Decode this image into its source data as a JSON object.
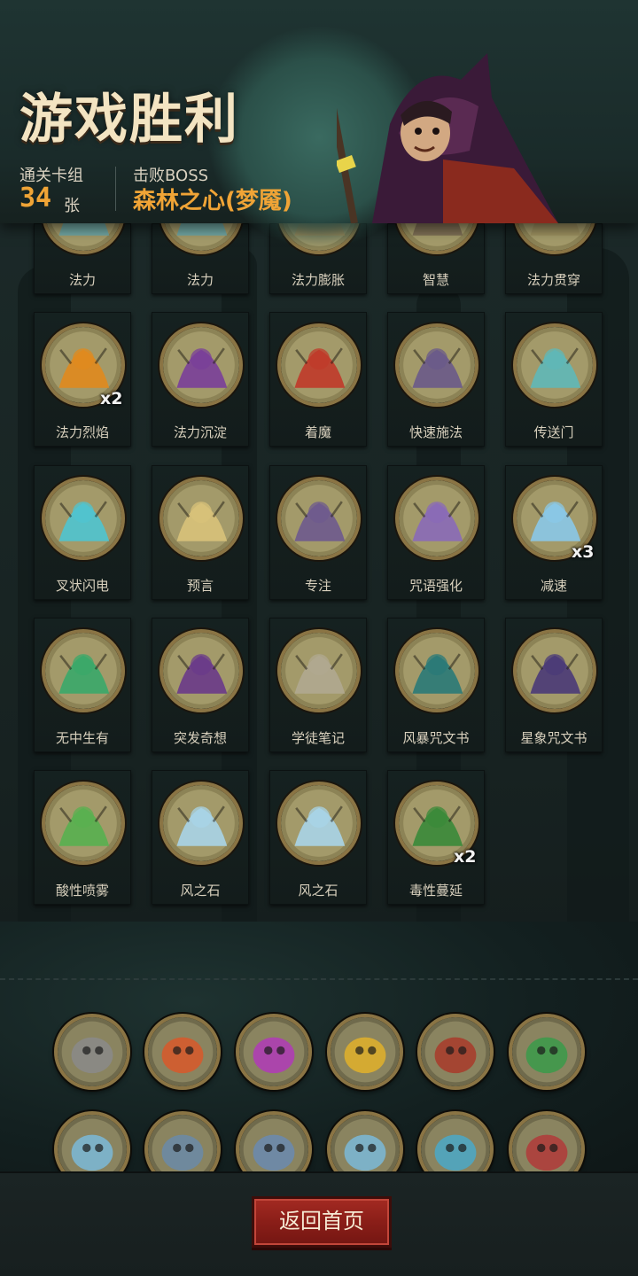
{
  "header": {
    "title": "游戏胜利",
    "deck_label": "通关卡组",
    "deck_count": "34",
    "deck_unit": "张",
    "boss_label": "击败BOSS",
    "boss_name": "森林之心(梦魇)"
  },
  "cards": [
    {
      "name": "法力",
      "count": "",
      "color": "#6aa7a8",
      "icon": "mana-eye-icon"
    },
    {
      "name": "法力",
      "count": "",
      "color": "#6aa7a8",
      "icon": "mana-eye-icon"
    },
    {
      "name": "法力膨胀",
      "count": "",
      "color": "#b5935a",
      "icon": "mana-swell-icon"
    },
    {
      "name": "智慧",
      "count": "",
      "color": "#7a6a52",
      "icon": "wisdom-icon"
    },
    {
      "name": "法力贯穿",
      "count": "",
      "color": "#9a8e5e",
      "icon": "mana-pierce-icon"
    },
    {
      "name": "法力烈焰",
      "count": "x2",
      "color": "#e08a1e",
      "icon": "mana-flame-icon"
    },
    {
      "name": "法力沉淀",
      "count": "",
      "color": "#7a3f9a",
      "icon": "mana-sediment-icon"
    },
    {
      "name": "着魔",
      "count": "",
      "color": "#c03a2a",
      "icon": "obsessed-icon"
    },
    {
      "name": "快速施法",
      "count": "",
      "color": "#6a5a8a",
      "icon": "quick-cast-icon"
    },
    {
      "name": "传送门",
      "count": "",
      "color": "#5fb8b8",
      "icon": "portal-icon"
    },
    {
      "name": "叉状闪电",
      "count": "",
      "color": "#4fc4d0",
      "icon": "fork-lightning-icon"
    },
    {
      "name": "预言",
      "count": "",
      "color": "#d8c27a",
      "icon": "prophecy-icon"
    },
    {
      "name": "专注",
      "count": "",
      "color": "#6e5a8e",
      "icon": "focus-icon"
    },
    {
      "name": "咒语强化",
      "count": "",
      "color": "#8a6ab8",
      "icon": "spell-boost-icon"
    },
    {
      "name": "减速",
      "count": "x3",
      "color": "#8ac8e8",
      "icon": "slow-icon"
    },
    {
      "name": "无中生有",
      "count": "",
      "color": "#3aa86a",
      "icon": "something-from-nothing-icon"
    },
    {
      "name": "突发奇想",
      "count": "",
      "color": "#6a3a8a",
      "icon": "sudden-idea-icon"
    },
    {
      "name": "学徒笔记",
      "count": "",
      "color": "#b0a890",
      "icon": "apprentice-notes-icon"
    },
    {
      "name": "风暴咒文书",
      "count": "",
      "color": "#2a7a78",
      "icon": "storm-spellbook-icon"
    },
    {
      "name": "星象咒文书",
      "count": "",
      "color": "#4a3a78",
      "icon": "astral-spellbook-icon"
    },
    {
      "name": "酸性喷雾",
      "count": "",
      "color": "#58b050",
      "icon": "acid-spray-icon"
    },
    {
      "name": "风之石",
      "count": "",
      "color": "#a8d4e8",
      "icon": "wind-stone-icon"
    },
    {
      "name": "风之石",
      "count": "",
      "color": "#a8d4e8",
      "icon": "wind-stone-icon"
    },
    {
      "name": "毒性蔓延",
      "count": "x2",
      "color": "#3a8a3a",
      "icon": "toxic-spread-icon"
    }
  ],
  "relics": [
    {
      "icon": "mirror-icon",
      "color": "#8a8a8a"
    },
    {
      "icon": "singing-skull-fire-icon",
      "color": "#d8582a"
    },
    {
      "icon": "singing-skull-arcane-icon",
      "color": "#b03ab8"
    },
    {
      "icon": "singing-skull-gold-icon",
      "color": "#e0b02a"
    },
    {
      "icon": "broken-sword-icon",
      "color": "#a83a2a"
    },
    {
      "icon": "green-smoke-icon",
      "color": "#3a9a4a"
    },
    {
      "icon": "frost-mirror-icon",
      "color": "#7ab8d8"
    },
    {
      "icon": "frame-hand-icon",
      "color": "#6a8aa8"
    },
    {
      "icon": "moon-dagger-icon",
      "color": "#6a8ab0"
    },
    {
      "icon": "frost-mirror-icon",
      "color": "#7ab8d8"
    },
    {
      "icon": "ice-creature-icon",
      "color": "#4aa8c8"
    },
    {
      "icon": "bloody-hand-icon",
      "color": "#b03a3a"
    }
  ],
  "footer": {
    "home_label": "返回首页"
  },
  "colors": {
    "accent": "#f0a436",
    "frame_gold": "#8a7444",
    "button_red": "#8a1e18"
  }
}
